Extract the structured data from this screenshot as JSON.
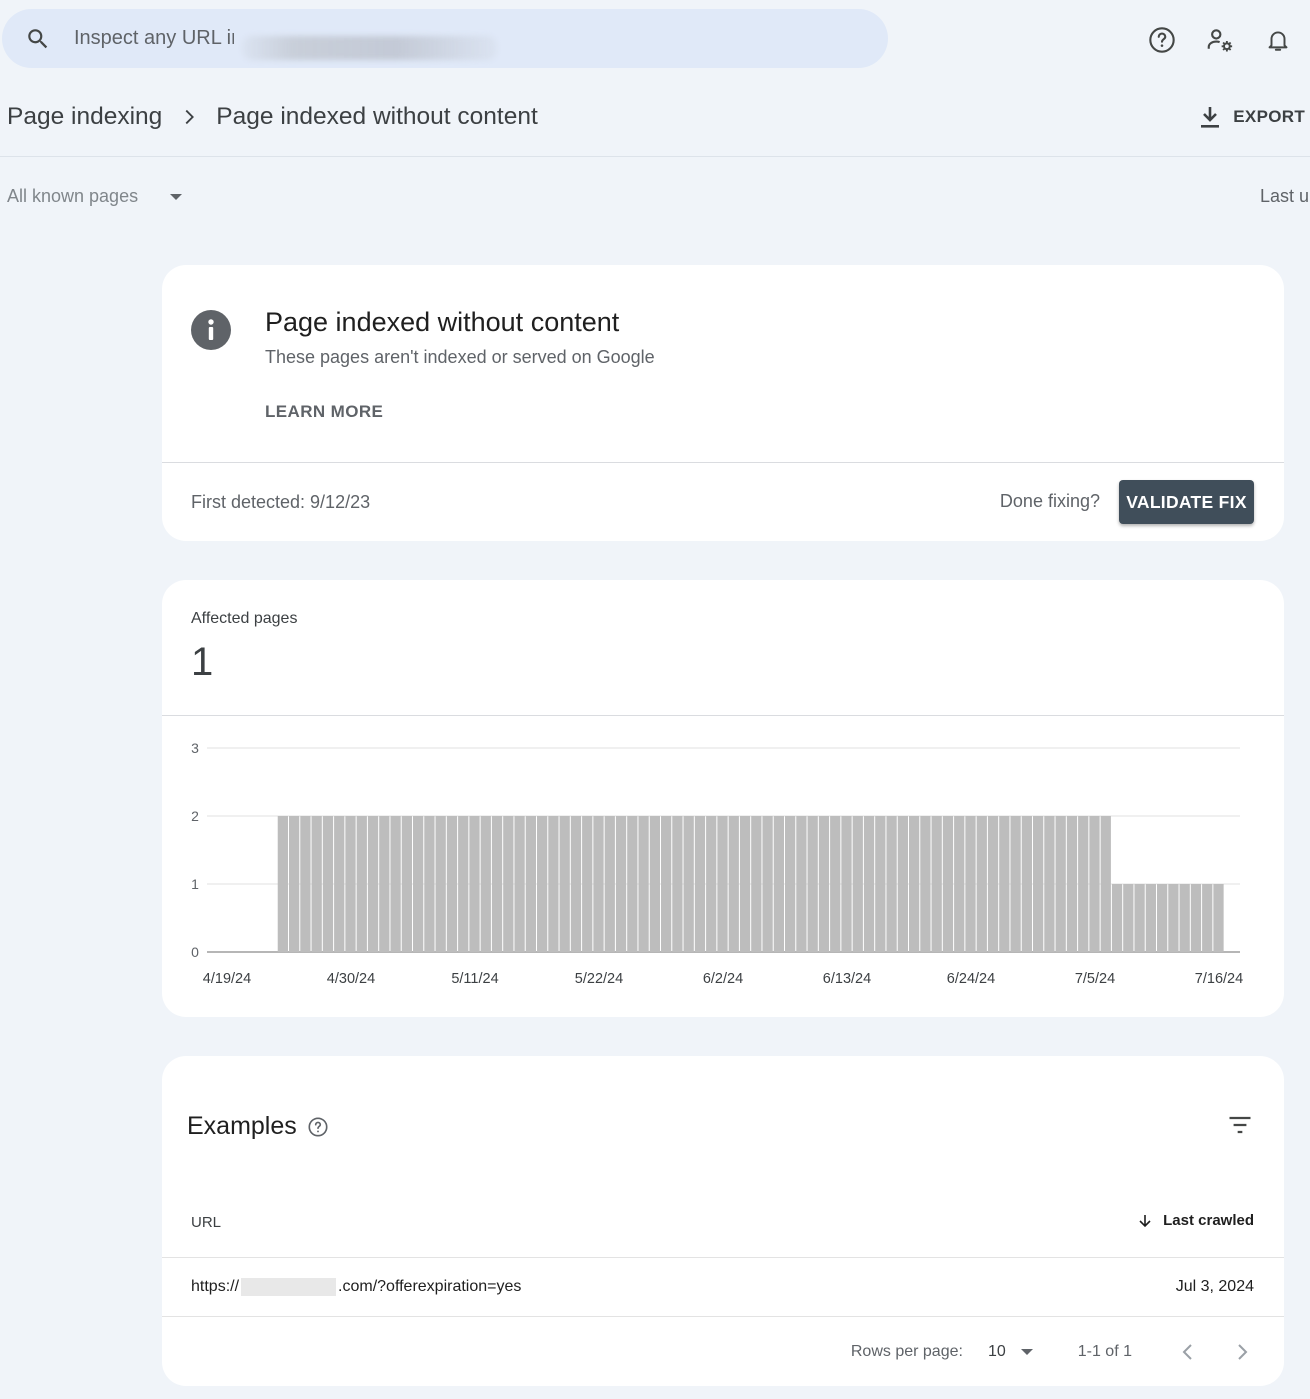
{
  "search": {
    "placeholder": "Inspect any URL in"
  },
  "header": {
    "breadcrumb_parent": "Page indexing",
    "breadcrumb_current": "Page indexed without content",
    "export_label": "EXPORT"
  },
  "filters": {
    "pages_filter": "All known pages",
    "last_updated": "Last u"
  },
  "issue": {
    "title": "Page indexed without content",
    "subtitle": "These pages aren't indexed or served on Google",
    "learn_more": "LEARN MORE",
    "first_detected": "First detected: 9/12/23",
    "done_fixing": "Done fixing?",
    "validate_label": "VALIDATE FIX"
  },
  "summary": {
    "affected_label": "Affected pages",
    "affected_value": "1"
  },
  "chart_data": {
    "type": "bar",
    "x_tick_labels": [
      "4/19/24",
      "4/30/24",
      "5/11/24",
      "5/22/24",
      "6/2/24",
      "6/13/24",
      "6/24/24",
      "7/5/24",
      "7/16/24"
    ],
    "y_ticks": [
      0,
      1,
      2,
      3
    ],
    "ylim": [
      0,
      3
    ],
    "grid": true,
    "bar_color": "#bdbdbd",
    "series": [
      {
        "date_range": [
          "4/19/24",
          "7/16/24"
        ],
        "segments": [
          {
            "from": "4/19/24",
            "to": "4/23/24",
            "value": 0
          },
          {
            "from": "4/24/24",
            "to": "7/6/24",
            "value": 2
          },
          {
            "from": "7/7/24",
            "to": "7/16/24",
            "value": 1
          }
        ]
      }
    ]
  },
  "examples": {
    "title": "Examples",
    "col_url": "URL",
    "col_last_crawled": "Last crawled",
    "rows": [
      {
        "url_prefix": "https://",
        "url_suffix": ".com/?offerexpiration=yes",
        "last_crawled": "Jul 3, 2024"
      }
    ],
    "rows_per_page_label": "Rows per page:",
    "rows_per_page_value": "10",
    "range_label": "1-1 of 1"
  }
}
